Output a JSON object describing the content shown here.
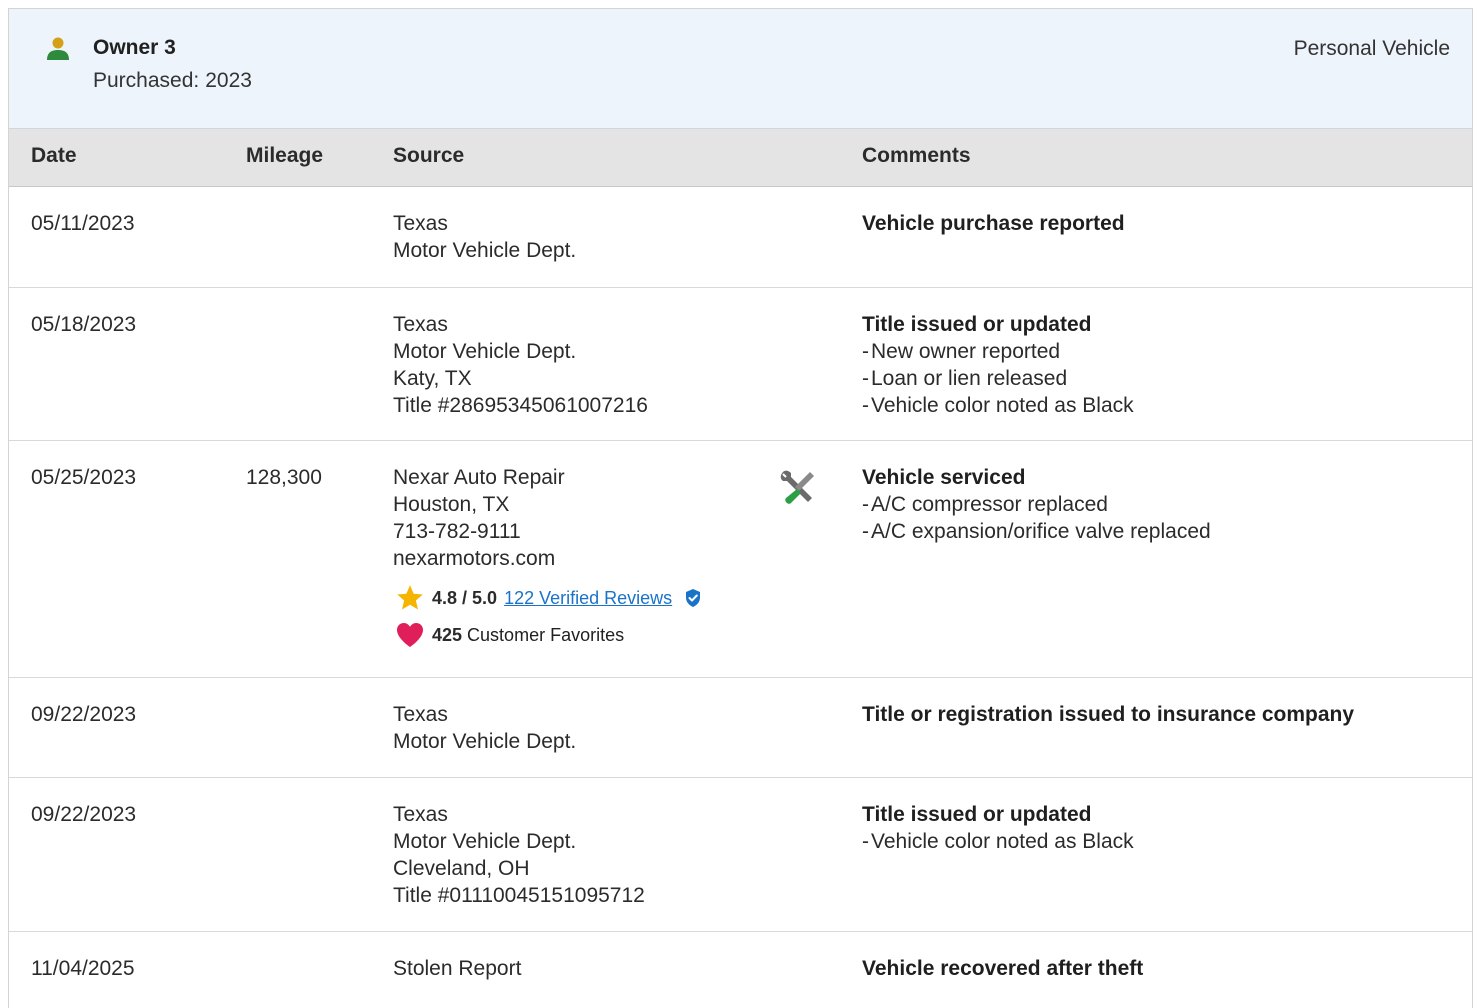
{
  "owner": {
    "name": "Owner 3",
    "purchased_label": "Purchased:",
    "purchased_year": "2023",
    "vehicle_type": "Personal Vehicle",
    "icon": "person-icon",
    "icon_colors": {
      "head": "#d4a017",
      "body": "#2e8b3e"
    }
  },
  "table": {
    "headers": {
      "date": "Date",
      "mileage": "Mileage",
      "source": "Source",
      "comments": "Comments"
    },
    "rows": [
      {
        "date": "05/11/2023",
        "mileage": "",
        "source": [
          "Texas",
          "Motor Vehicle Dept."
        ],
        "comment_title": "Vehicle purchase reported",
        "comment_items": []
      },
      {
        "date": "05/18/2023",
        "mileage": "",
        "source": [
          "Texas",
          "Motor Vehicle Dept.",
          "Katy, TX",
          "Title #28695345061007216"
        ],
        "comment_title": "Title issued or updated",
        "comment_items": [
          "New owner reported",
          "Loan or lien released",
          "Vehicle color noted as Black"
        ]
      },
      {
        "date": "05/25/2023",
        "mileage": "128,300",
        "source": [
          "Nexar Auto Repair",
          "Houston, TX",
          "713-782-9111",
          "nexarmotors.com"
        ],
        "service_icon": "wrench-screwdriver-icon",
        "rating": {
          "score": "4.8 / 5.0",
          "reviews_link": "122 Verified Reviews",
          "star_icon": "star-icon",
          "verified_icon": "verified-badge-icon"
        },
        "favorites": {
          "count": "425",
          "label": "Customer Favorites",
          "heart_icon": "heart-icon"
        },
        "comment_title": "Vehicle serviced",
        "comment_items": [
          "A/C compressor replaced",
          "A/C expansion/orifice valve replaced"
        ]
      },
      {
        "date": "09/22/2023",
        "mileage": "",
        "source": [
          "Texas",
          "Motor Vehicle Dept."
        ],
        "comment_title": "Title or registration issued to insurance company",
        "comment_items": []
      },
      {
        "date": "09/22/2023",
        "mileage": "",
        "source": [
          "Texas",
          "Motor Vehicle Dept.",
          "Cleveland, OH",
          "Title #01110045151095712"
        ],
        "comment_title": "Title issued or updated",
        "comment_items": [
          "Vehicle color noted as Black"
        ]
      },
      {
        "date": "11/04/2025",
        "mileage": "",
        "source": [
          "Stolen Report"
        ],
        "comment_title": "Vehicle recovered after theft",
        "comment_items": []
      }
    ]
  },
  "colors": {
    "header_bg": "#eef4fb",
    "table_head_bg": "#e4e4e4",
    "link": "#1a73c8",
    "star": "#f5b400",
    "heart": "#e01e5a",
    "verified": "#1a73c8",
    "tool_green": "#2e9e44",
    "tool_gray": "#6b6b6b"
  }
}
